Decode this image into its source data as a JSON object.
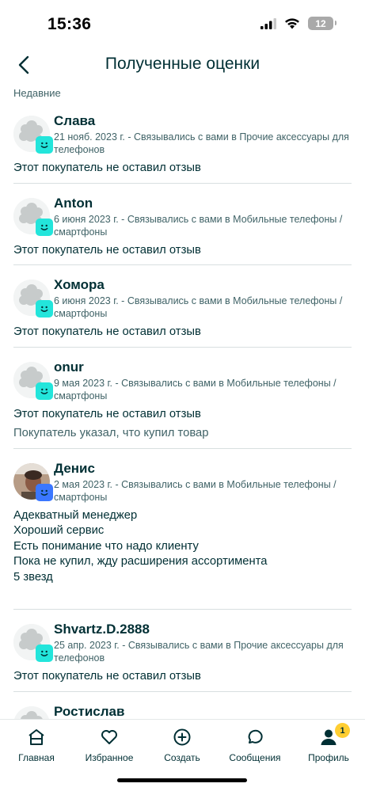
{
  "status": {
    "time": "15:36",
    "battery": "12"
  },
  "header": {
    "title": "Полученные оценки"
  },
  "section": {
    "label": "Недавние"
  },
  "reviews": [
    {
      "name": "Слава",
      "meta": "21 нояб. 2023 г. - Связывались с вами в Прочие аксессуары для телефонов",
      "body": [
        "Этот покупатель не оставил отзыв"
      ],
      "extra": ""
    },
    {
      "name": "Anton",
      "meta": "6 июня 2023 г. - Связывались с вами в Мобильные телефоны / смартфоны",
      "body": [
        "Этот покупатель не оставил отзыв"
      ],
      "extra": ""
    },
    {
      "name": "Хомора",
      "meta": "6 июня 2023 г. - Связывались с вами в Мобильные телефоны / смартфоны",
      "body": [
        "Этот покупатель не оставил отзыв"
      ],
      "extra": ""
    },
    {
      "name": "onur",
      "meta": "9 мая 2023 г. - Связывались с вами в Мобильные телефоны / смартфоны",
      "body": [
        "Этот покупатель не оставил отзыв"
      ],
      "extra": "Покупатель указал, что купил товар"
    },
    {
      "name": "Денис",
      "meta": "2 мая 2023 г. - Связывались с вами в Мобильные телефоны / смартфоны",
      "body": [
        "Адекватный менеджер",
        "Хороший сервис",
        "Есть понимание что надо клиенту",
        "Пока не купил, жду расширения ассортимента",
        "5 звезд"
      ],
      "extra": ""
    },
    {
      "name": "Shvartz.D.2888",
      "meta": "25 апр. 2023 г. - Связывались с вами в Прочие аксессуары для телефонов",
      "body": [
        "Этот покупатель не оставил отзыв"
      ],
      "extra": ""
    },
    {
      "name": "Ростислав",
      "meta": "",
      "body": [],
      "extra": ""
    }
  ],
  "tabs": [
    {
      "label": "Главная",
      "icon": "home-icon"
    },
    {
      "label": "Избранное",
      "icon": "heart-icon"
    },
    {
      "label": "Создать",
      "icon": "plus-circle-icon"
    },
    {
      "label": "Сообщения",
      "icon": "chat-icon"
    },
    {
      "label": "Профиль",
      "icon": "profile-icon",
      "badge": "1"
    }
  ],
  "colors": {
    "primary": "#002f34",
    "badge_cyan": "#23e5db",
    "badge_blue": "#3a77ff",
    "notification": "#ffce32"
  }
}
